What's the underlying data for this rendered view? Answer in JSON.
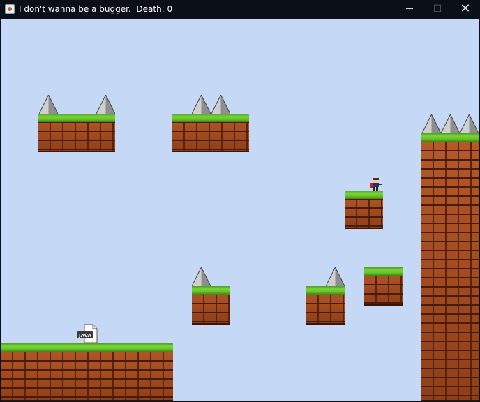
{
  "window": {
    "title": "I don't wanna be a bugger.  Death: 0",
    "buttons": {
      "minimize": "─",
      "maximize": "☐",
      "close": "✕"
    },
    "app_icon": "java-app-icon"
  },
  "game": {
    "background_color": "#c5d8f6",
    "death_count": 0,
    "player": "kid-player-sprite",
    "file_icon_label": "JAVA",
    "colors": {
      "grass": "#68c229",
      "brick": "#a14a1e",
      "spike": "#e0e0e0"
    }
  }
}
